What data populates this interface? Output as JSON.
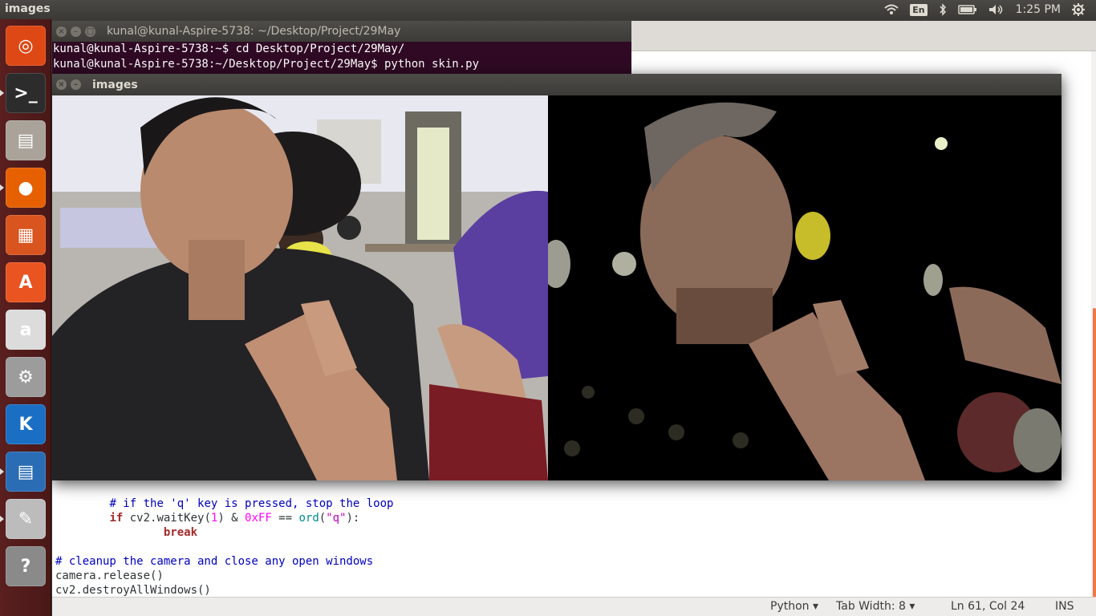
{
  "top_panel": {
    "app_title": "images",
    "keyboard_layout": "En",
    "clock": "1:25 PM"
  },
  "launcher": {
    "items": [
      {
        "name": "ubuntu-home-icon",
        "color": "#dd4814"
      },
      {
        "name": "terminal-icon",
        "color": "#2c2c2c"
      },
      {
        "name": "files-icon",
        "color": "#a9a39a"
      },
      {
        "name": "firefox-icon",
        "color": "#e66000"
      },
      {
        "name": "impress-icon",
        "color": "#d9541e"
      },
      {
        "name": "software-center-icon",
        "color": "#e95420"
      },
      {
        "name": "amazon-icon",
        "color": "#dcdcdc"
      },
      {
        "name": "system-settings-icon",
        "color": "#9c9c9c"
      },
      {
        "name": "kile-icon",
        "color": "#1a6fc4"
      },
      {
        "name": "writer-icon",
        "color": "#2a6db5"
      },
      {
        "name": "text-editor-icon",
        "color": "#bcbcbc"
      },
      {
        "name": "help-icon",
        "color": "#8a8a8a"
      }
    ]
  },
  "terminal": {
    "title": "kunal@kunal-Aspire-5738: ~/Desktop/Project/29May",
    "lines": [
      "kunal@kunal-Aspire-5738:~$ cd Desktop/Project/29May/",
      "kunal@kunal-Aspire-5738:~/Desktop/Project/29May$ python skin.py"
    ]
  },
  "images_window": {
    "title": "images"
  },
  "editor": {
    "code": {
      "line1_comment": "# if the 'q' key is pressed, stop the loop",
      "line2_if": "if",
      "line2_a": " cv2.waitKey(",
      "line2_num1": "1",
      "line2_b": ") & ",
      "line2_hex": "0xFF",
      "line2_c": " == ",
      "line2_ord": "ord",
      "line2_d": "(",
      "line2_str": "\"q\"",
      "line2_e": "):",
      "line3_break": "break",
      "line5_comment": "# cleanup the camera and close any open windows",
      "line6": "camera.release()",
      "line7": "cv2.destroyAllWindows()"
    },
    "status": {
      "language": "Python ▾",
      "tab_width": "Tab Width: 8 ▾",
      "position": "Ln 61, Col 24",
      "mode": "INS"
    }
  }
}
